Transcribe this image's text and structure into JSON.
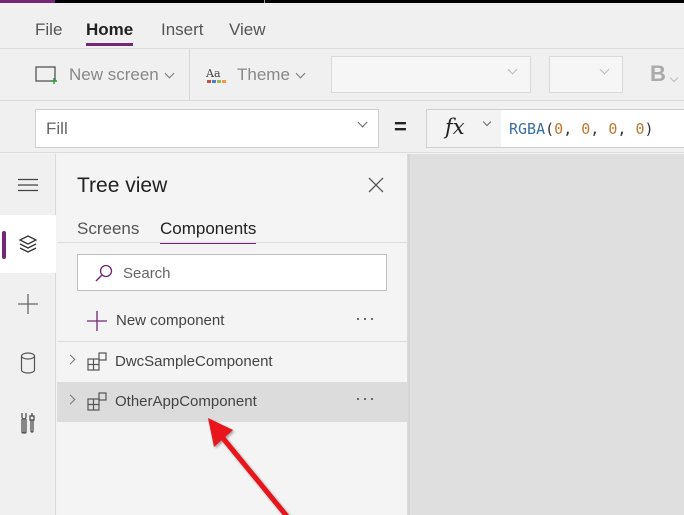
{
  "menu": {
    "tabs": [
      {
        "label": "File",
        "active": false
      },
      {
        "label": "Home",
        "active": true
      },
      {
        "label": "Insert",
        "active": false
      },
      {
        "label": "View",
        "active": false
      }
    ]
  },
  "ribbon": {
    "new_screen_label": "New screen",
    "theme_label": "Theme",
    "font_select_value": "",
    "font_size_value": "",
    "bold_label": "B"
  },
  "formula_bar": {
    "property": "Fill",
    "equals": "=",
    "fx_label": "fx",
    "formula": {
      "function": "RGBA",
      "open": "(",
      "args": [
        "0",
        "0",
        "0",
        "0"
      ],
      "sep": ", ",
      "close": ")"
    }
  },
  "rail": {
    "items": [
      {
        "icon": "hamburger-menu-icon",
        "active": false
      },
      {
        "icon": "layers-icon",
        "active": true
      },
      {
        "icon": "plus-icon",
        "active": false
      },
      {
        "icon": "database-icon",
        "active": false
      },
      {
        "icon": "tools-icon",
        "active": false
      }
    ]
  },
  "tree_view": {
    "title": "Tree view",
    "tabs": [
      {
        "label": "Screens",
        "active": false
      },
      {
        "label": "Components",
        "active": true
      }
    ],
    "search_placeholder": "Search",
    "new_component_label": "New component",
    "more_label": "···",
    "items": [
      {
        "label": "DwcSampleComponent",
        "selected": false
      },
      {
        "label": "OtherAppComponent",
        "selected": true
      }
    ]
  },
  "colors": {
    "accent": "#742774",
    "annotation_arrow": "#e8141a",
    "canvas": "#dfdfdf"
  },
  "annotation": {
    "type": "arrow",
    "points_to": "OtherAppComponent"
  }
}
